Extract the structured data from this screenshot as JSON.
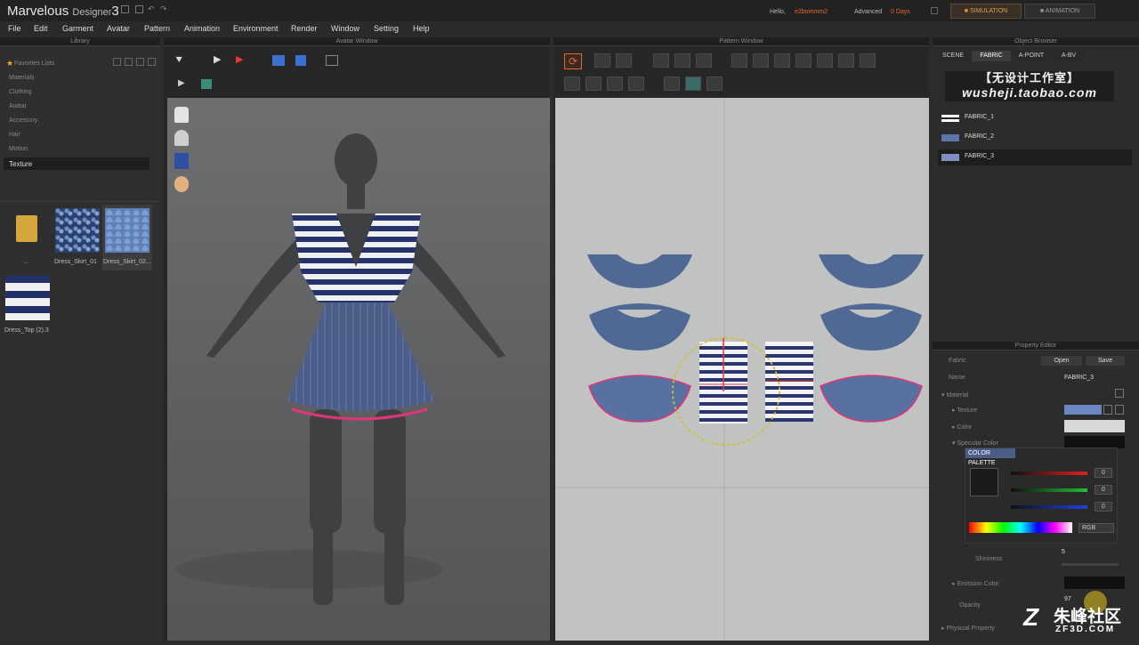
{
  "app": {
    "name": "Marvelous",
    "sub": "Designer",
    "version": "3",
    "hello": "Hello,",
    "user": "e2bommm2",
    "license": "Advanced",
    "days": "0 Days",
    "mode_sim": "SIMULATION",
    "mode_ani": "ANIMATION"
  },
  "menu": [
    "File",
    "Edit",
    "Garment",
    "Avatar",
    "Pattern",
    "Animation",
    "Environment",
    "Render",
    "Window",
    "Setting",
    "Help"
  ],
  "library": {
    "title": "Library",
    "items": [
      "Favorites Lists",
      "Materials",
      "Clothing",
      "Avatar",
      "Accessory",
      "Hair",
      "Motion"
    ],
    "selected": "Texture",
    "thumbs": [
      {
        "label": ".."
      },
      {
        "label": "Dress_Skirt_01"
      },
      {
        "label": "Dress_Skirt_02..."
      },
      {
        "label": "Dress_Top (2).3"
      }
    ]
  },
  "avatar_window": {
    "title": "Avatar Window"
  },
  "pattern_window": {
    "title": "Pattern Window"
  },
  "object_browser": {
    "title": "Object Browser",
    "tabs": [
      "SCENE",
      "FABRIC",
      "A-POINT",
      "A-BV"
    ],
    "fabrics": [
      "FABRIC_1",
      "FABRIC_2",
      "FABRIC_3"
    ],
    "selected": "FABRIC_3"
  },
  "property_editor": {
    "title": "Property Editor",
    "fabric_label": "Fabric",
    "open": "Open",
    "save": "Save",
    "name_label": "Name",
    "name_value": "FABRIC_3",
    "material": "Material",
    "texture": "Texture",
    "color": "Color",
    "specular": "Specular Color",
    "palette": "COLOR PALETTE",
    "r": "0",
    "g": "0",
    "b": "0",
    "mode": "RGB",
    "shininess_label": "Shininess",
    "shininess_value": "5",
    "emission": "Emission Color",
    "opacity_label": "Opacity",
    "opacity_value": "97",
    "physical": "Physical Property"
  },
  "watermark": {
    "line1": "【无设计工作室】",
    "line2": "wusheji.taobao.com",
    "brand": "朱峰社区",
    "brand_sub": "ZF3D.COM"
  },
  "colors": {
    "accent": "#e8652a",
    "fabric_blue": "#4f6894",
    "stripe_navy": "#26336a",
    "highlight": "#e0357a"
  }
}
